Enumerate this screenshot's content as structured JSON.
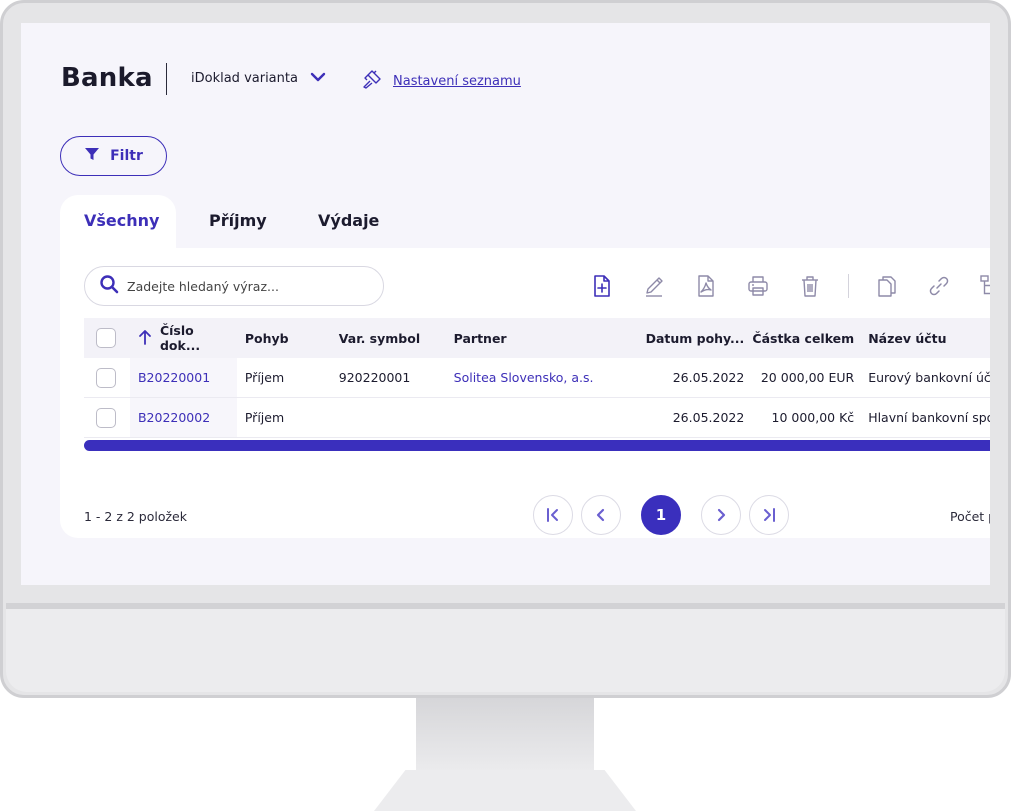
{
  "header": {
    "title": "Banka",
    "variant_label": "iDoklad varianta",
    "settings_link": "Nastavení seznamu"
  },
  "filter": {
    "label": "Filtr"
  },
  "tabs": [
    {
      "label": "Všechny",
      "active": true
    },
    {
      "label": "Příjmy",
      "active": false
    },
    {
      "label": "Výdaje",
      "active": false
    }
  ],
  "search": {
    "placeholder": "Zadejte hledaný výraz..."
  },
  "toolbar": {
    "icons": [
      "new-document-icon",
      "edit-icon",
      "pdf-icon",
      "print-icon",
      "delete-icon",
      "copy-icon",
      "link-icon",
      "tree-icon"
    ]
  },
  "table": {
    "columns": [
      "Číslo dok...",
      "Pohyb",
      "Var. symbol",
      "Partner",
      "Datum pohy...",
      "Částka celkem",
      "Název účtu"
    ],
    "rows": [
      {
        "cislo": "B20220001",
        "pohyb": "Příjem",
        "var_symbol": "920220001",
        "partner": "Solitea Slovensko, a.s.",
        "datum": "26.05.2022",
        "castka": "20 000,00 EUR",
        "ucet": "Eurový bankovní úče"
      },
      {
        "cislo": "B20220002",
        "pohyb": "Příjem",
        "var_symbol": "",
        "partner": "",
        "datum": "26.05.2022",
        "castka": "10 000,00 Kč",
        "ucet": "Hlavní bankovní spo"
      }
    ]
  },
  "footer": {
    "items_count": "1 - 2 z 2 položek",
    "current_page": "1",
    "per_page_label": "Počet p"
  },
  "colors": {
    "accent": "#3d2fb8",
    "background": "#f6f5fb"
  }
}
